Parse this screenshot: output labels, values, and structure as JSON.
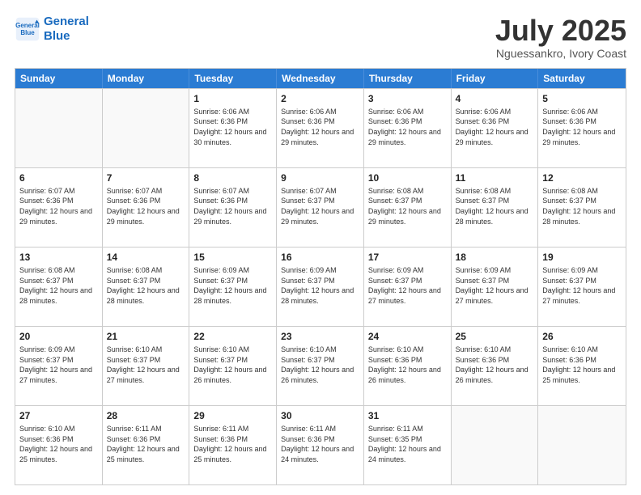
{
  "header": {
    "logo_line1": "General",
    "logo_line2": "Blue",
    "month": "July 2025",
    "location": "Nguessankro, Ivory Coast"
  },
  "days_of_week": [
    "Sunday",
    "Monday",
    "Tuesday",
    "Wednesday",
    "Thursday",
    "Friday",
    "Saturday"
  ],
  "weeks": [
    [
      {
        "day": "",
        "detail": "",
        "empty": true
      },
      {
        "day": "",
        "detail": "",
        "empty": true
      },
      {
        "day": "1",
        "detail": "Sunrise: 6:06 AM\nSunset: 6:36 PM\nDaylight: 12 hours and 30 minutes."
      },
      {
        "day": "2",
        "detail": "Sunrise: 6:06 AM\nSunset: 6:36 PM\nDaylight: 12 hours and 29 minutes."
      },
      {
        "day": "3",
        "detail": "Sunrise: 6:06 AM\nSunset: 6:36 PM\nDaylight: 12 hours and 29 minutes."
      },
      {
        "day": "4",
        "detail": "Sunrise: 6:06 AM\nSunset: 6:36 PM\nDaylight: 12 hours and 29 minutes."
      },
      {
        "day": "5",
        "detail": "Sunrise: 6:06 AM\nSunset: 6:36 PM\nDaylight: 12 hours and 29 minutes."
      }
    ],
    [
      {
        "day": "6",
        "detail": "Sunrise: 6:07 AM\nSunset: 6:36 PM\nDaylight: 12 hours and 29 minutes."
      },
      {
        "day": "7",
        "detail": "Sunrise: 6:07 AM\nSunset: 6:36 PM\nDaylight: 12 hours and 29 minutes."
      },
      {
        "day": "8",
        "detail": "Sunrise: 6:07 AM\nSunset: 6:36 PM\nDaylight: 12 hours and 29 minutes."
      },
      {
        "day": "9",
        "detail": "Sunrise: 6:07 AM\nSunset: 6:37 PM\nDaylight: 12 hours and 29 minutes."
      },
      {
        "day": "10",
        "detail": "Sunrise: 6:08 AM\nSunset: 6:37 PM\nDaylight: 12 hours and 29 minutes."
      },
      {
        "day": "11",
        "detail": "Sunrise: 6:08 AM\nSunset: 6:37 PM\nDaylight: 12 hours and 28 minutes."
      },
      {
        "day": "12",
        "detail": "Sunrise: 6:08 AM\nSunset: 6:37 PM\nDaylight: 12 hours and 28 minutes."
      }
    ],
    [
      {
        "day": "13",
        "detail": "Sunrise: 6:08 AM\nSunset: 6:37 PM\nDaylight: 12 hours and 28 minutes."
      },
      {
        "day": "14",
        "detail": "Sunrise: 6:08 AM\nSunset: 6:37 PM\nDaylight: 12 hours and 28 minutes."
      },
      {
        "day": "15",
        "detail": "Sunrise: 6:09 AM\nSunset: 6:37 PM\nDaylight: 12 hours and 28 minutes."
      },
      {
        "day": "16",
        "detail": "Sunrise: 6:09 AM\nSunset: 6:37 PM\nDaylight: 12 hours and 28 minutes."
      },
      {
        "day": "17",
        "detail": "Sunrise: 6:09 AM\nSunset: 6:37 PM\nDaylight: 12 hours and 27 minutes."
      },
      {
        "day": "18",
        "detail": "Sunrise: 6:09 AM\nSunset: 6:37 PM\nDaylight: 12 hours and 27 minutes."
      },
      {
        "day": "19",
        "detail": "Sunrise: 6:09 AM\nSunset: 6:37 PM\nDaylight: 12 hours and 27 minutes."
      }
    ],
    [
      {
        "day": "20",
        "detail": "Sunrise: 6:09 AM\nSunset: 6:37 PM\nDaylight: 12 hours and 27 minutes."
      },
      {
        "day": "21",
        "detail": "Sunrise: 6:10 AM\nSunset: 6:37 PM\nDaylight: 12 hours and 27 minutes."
      },
      {
        "day": "22",
        "detail": "Sunrise: 6:10 AM\nSunset: 6:37 PM\nDaylight: 12 hours and 26 minutes."
      },
      {
        "day": "23",
        "detail": "Sunrise: 6:10 AM\nSunset: 6:37 PM\nDaylight: 12 hours and 26 minutes."
      },
      {
        "day": "24",
        "detail": "Sunrise: 6:10 AM\nSunset: 6:36 PM\nDaylight: 12 hours and 26 minutes."
      },
      {
        "day": "25",
        "detail": "Sunrise: 6:10 AM\nSunset: 6:36 PM\nDaylight: 12 hours and 26 minutes."
      },
      {
        "day": "26",
        "detail": "Sunrise: 6:10 AM\nSunset: 6:36 PM\nDaylight: 12 hours and 25 minutes."
      }
    ],
    [
      {
        "day": "27",
        "detail": "Sunrise: 6:10 AM\nSunset: 6:36 PM\nDaylight: 12 hours and 25 minutes."
      },
      {
        "day": "28",
        "detail": "Sunrise: 6:11 AM\nSunset: 6:36 PM\nDaylight: 12 hours and 25 minutes."
      },
      {
        "day": "29",
        "detail": "Sunrise: 6:11 AM\nSunset: 6:36 PM\nDaylight: 12 hours and 25 minutes."
      },
      {
        "day": "30",
        "detail": "Sunrise: 6:11 AM\nSunset: 6:36 PM\nDaylight: 12 hours and 24 minutes."
      },
      {
        "day": "31",
        "detail": "Sunrise: 6:11 AM\nSunset: 6:35 PM\nDaylight: 12 hours and 24 minutes."
      },
      {
        "day": "",
        "detail": "",
        "empty": true
      },
      {
        "day": "",
        "detail": "",
        "empty": true
      }
    ]
  ]
}
